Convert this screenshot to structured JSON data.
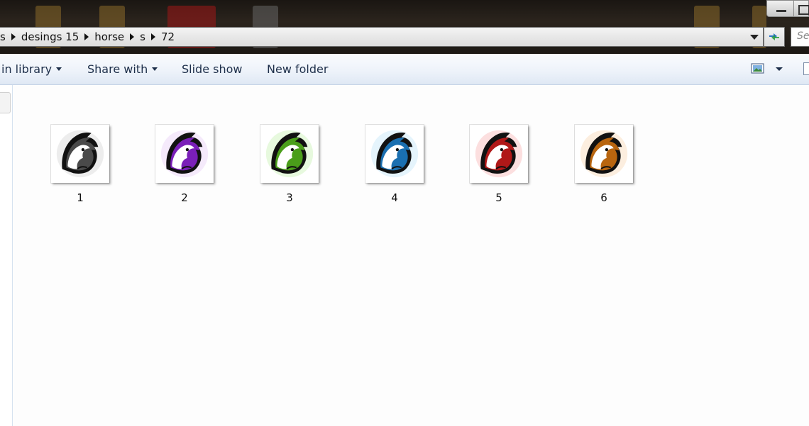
{
  "breadcrumb": {
    "items": [
      "s",
      "desings 15",
      "horse",
      "s",
      "72"
    ]
  },
  "search": {
    "placeholder": "Se"
  },
  "commandbar": {
    "include_in_library": "in library",
    "share_with": "Share with",
    "slide_show": "Slide show",
    "new_folder": "New folder"
  },
  "files": [
    {
      "name": "1",
      "color": "#4a4a4a",
      "accent": "#9a9a9a"
    },
    {
      "name": "2",
      "color": "#7a1fb8",
      "accent": "#c98ae8"
    },
    {
      "name": "3",
      "color": "#4a9e1a",
      "accent": "#7be04a"
    },
    {
      "name": "4",
      "color": "#1a6fb0",
      "accent": "#6ec0f0"
    },
    {
      "name": "5",
      "color": "#b01818",
      "accent": "#f05050"
    },
    {
      "name": "6",
      "color": "#b8650f",
      "accent": "#f0a050"
    }
  ],
  "colors": {
    "commandbar_text": "#1e2f4a",
    "titlebar_bg": "#1d1915"
  }
}
